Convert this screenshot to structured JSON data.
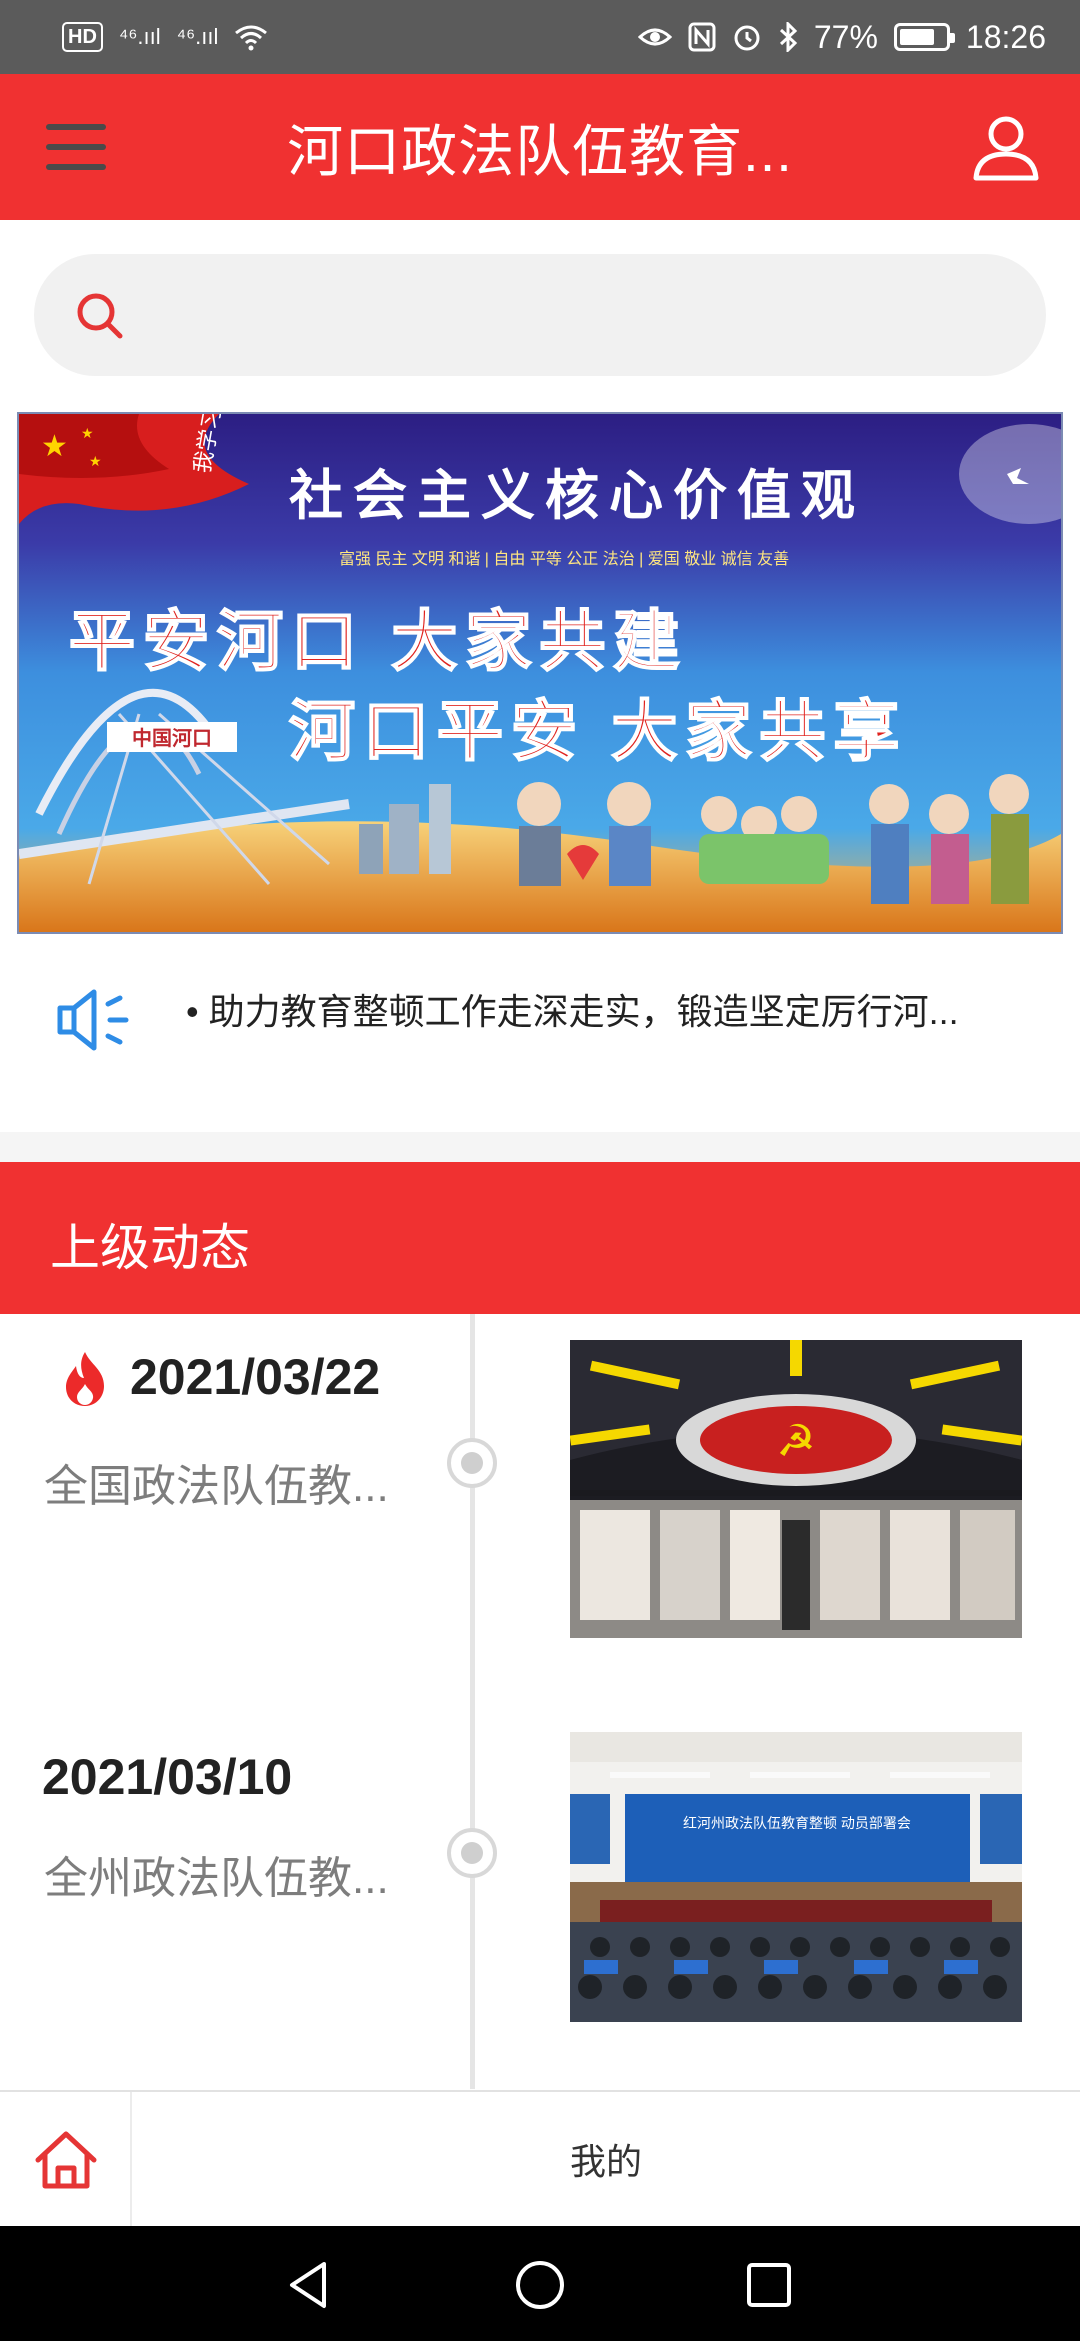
{
  "status_bar": {
    "hd_badge": "HD",
    "net1": "⁴⁶.ııl",
    "net2": "⁴⁶.ııl",
    "battery": "77%",
    "time": "18:26",
    "battery_level": 0.77
  },
  "header": {
    "title": "河口政法队伍教育..."
  },
  "search": {
    "placeholder": ""
  },
  "banner": {
    "heading": "社会主义核心价值观",
    "values_line": "富强 民主 文明 和谐 | 自由 平等 公正 法治 | 爱国 敬业 诚信 友善",
    "slogan1": "平安河口  大家共建",
    "slogan2": "河口平安  大家共享",
    "sign": "中国河口",
    "calligraphy": "我学习 我践行"
  },
  "notice": {
    "text": "• 助力教育整顿工作走深走实，锻造坚定厉行河..."
  },
  "section": {
    "title": "上级动态"
  },
  "timeline": {
    "items": [
      {
        "date": "2021/03/22",
        "desc": "全国政法队伍教...",
        "hot": true
      },
      {
        "date": "2021/03/10",
        "desc": "全州政法队伍教...",
        "hot": false
      }
    ],
    "meeting_banner": "红河州政法队伍教育整顿 动员部署会"
  },
  "tabbar": {
    "mine_label": "我的"
  },
  "colors": {
    "primary": "#f03131",
    "status_bar": "#5b5b5b"
  }
}
